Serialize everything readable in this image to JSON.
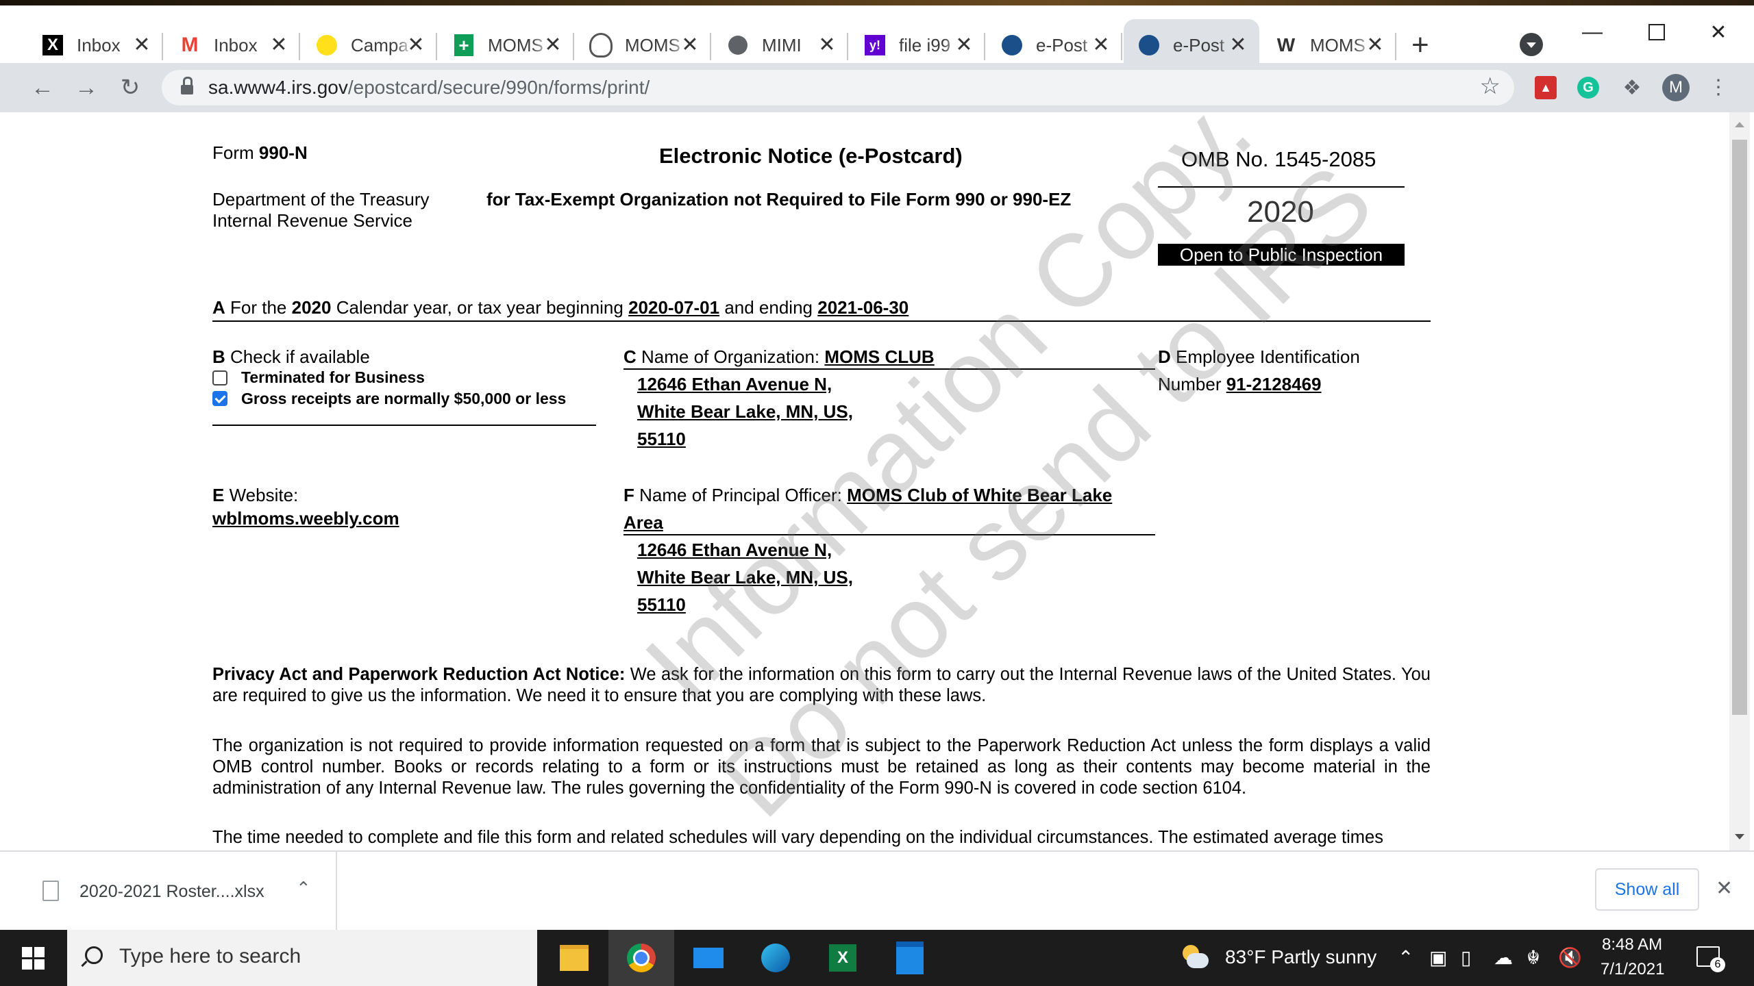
{
  "tabs": [
    {
      "title": "Inbox",
      "icon": "x-logo-icon"
    },
    {
      "title": "Inbox",
      "icon": "gmail-icon"
    },
    {
      "title": "Campa",
      "icon": "mailchimp-icon"
    },
    {
      "title": "MOMS",
      "icon": "sheets-plus-icon"
    },
    {
      "title": "MOMS",
      "icon": "fingerprint-icon"
    },
    {
      "title": "MIMI",
      "icon": "globe-icon"
    },
    {
      "title": "file i99",
      "icon": "yahoo-icon"
    },
    {
      "title": "e-Post",
      "icon": "irs-eagle-icon"
    },
    {
      "title": "e-Post",
      "icon": "irs-eagle-icon",
      "active": true
    },
    {
      "title": "MOMS",
      "icon": "wix-icon"
    }
  ],
  "url": {
    "host": "sa.www4.irs.gov",
    "path": "/epostcard/secure/990n/forms/print/"
  },
  "profile_initial": "M",
  "form": {
    "form_label": "Form",
    "form_number": "990-N",
    "title": "Electronic Notice (e-Postcard)",
    "subtitle": "for Tax-Exempt Organization not Required to File Form 990 or 990-EZ",
    "dept_line1": "Department of the Treasury",
    "dept_line2": "Internal Revenue Service",
    "omb": "OMB No. 1545-2085",
    "year": "2020",
    "public_inspection": "Open to Public Inspection",
    "section_a": {
      "letter": "A",
      "text1": "For the",
      "year": "2020",
      "text2": "Calendar year, or tax year beginning",
      "begin": "2020-07-01",
      "text3": "and ending",
      "end": "2021-06-30"
    },
    "section_b": {
      "letter": "B",
      "label": "Check if available",
      "options": [
        {
          "label": "Terminated for Business",
          "checked": false
        },
        {
          "label": "Gross receipts are normally $50,000 or less",
          "checked": true
        }
      ]
    },
    "section_c": {
      "letter": "C",
      "label": "Name of Organization:",
      "name": "MOMS CLUB",
      "address1": "12646 Ethan Avenue N,",
      "address2": "White Bear Lake, MN, US,",
      "address3": "55110"
    },
    "section_d": {
      "letter": "D",
      "label1": "Employee Identification",
      "label2": "Number",
      "ein": "91-2128469"
    },
    "section_e": {
      "letter": "E",
      "label": "Website:",
      "website": "wblmoms.weebly.com"
    },
    "section_f": {
      "letter": "F",
      "label": "Name of Principal Officer:",
      "name1": "MOMS Club of White Bear Lake",
      "name2": "Area",
      "address1": "12646 Ethan Avenue N,",
      "address2": "White Bear Lake, MN, US,",
      "address3": "55110"
    },
    "privacy_heading": "Privacy Act and Paperwork Reduction Act Notice:",
    "privacy_text": "We ask for the information on this form to carry out the Internal Revenue laws of the United States. You are required to give us the information. We need it to ensure that you are complying with these laws.",
    "paperwork_text": "The organization is not required to provide information requested on a form that is subject to the Paperwork Reduction Act unless the form displays a valid OMB control number. Books or records relating to a form or its instructions must be retained as long as their contents may become material in the administration of any Internal Revenue law. The rules governing the confidentiality of the Form 990-N is covered in code section 6104.",
    "time_text": "The time needed to complete and file this form and related schedules will vary depending on the individual circumstances. The estimated average times",
    "watermark_line1": "Information Copy.",
    "watermark_line2": "Do not send to IRS"
  },
  "download": {
    "filename": "2020-2021 Roster....xlsx",
    "show_all": "Show all"
  },
  "taskbar": {
    "search_placeholder": "Type here to search",
    "weather": "83°F  Partly sunny",
    "time": "8:48 AM",
    "date": "7/1/2021",
    "notification_count": "6"
  }
}
